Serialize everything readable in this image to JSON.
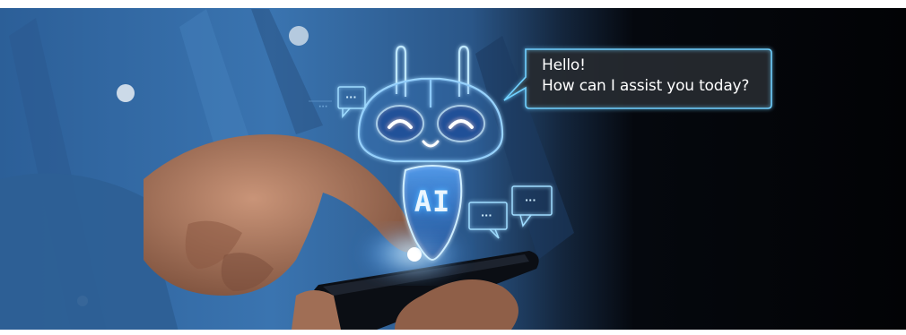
{
  "speech_bubble": {
    "line1": "Hello!",
    "line2": "How can I assist you today?"
  },
  "robot": {
    "badge": "AI"
  },
  "small_bubbles": [
    "...",
    "...",
    "..."
  ],
  "colors": {
    "denim": "#3a6ea8",
    "neon": "#6fd0ff",
    "background_dark": "#05070c",
    "skin": "#b98268"
  }
}
